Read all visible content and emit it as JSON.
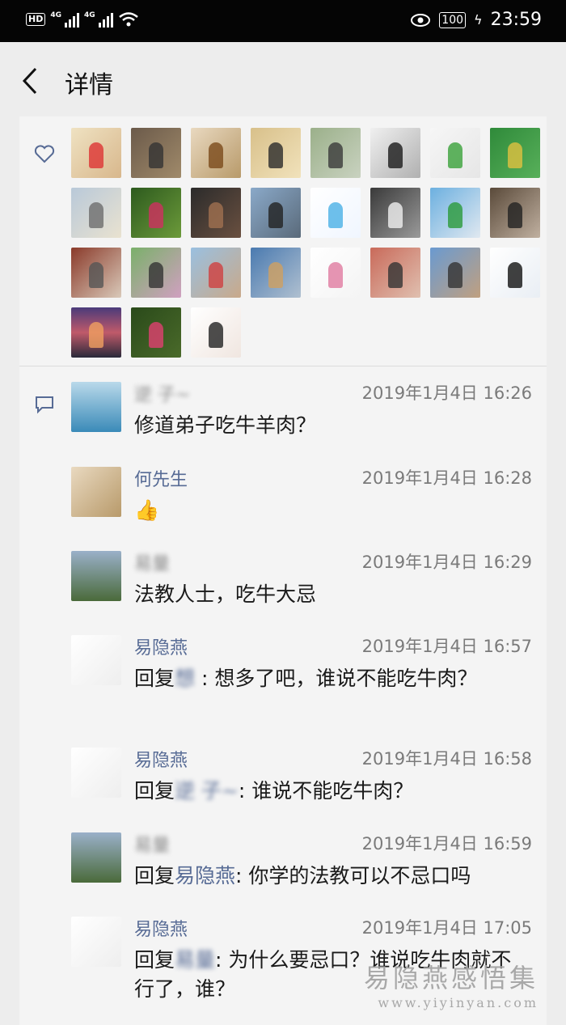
{
  "status_bar": {
    "hd": "HD",
    "network1": "4G",
    "network2": "4G",
    "battery": "100",
    "time": "23:59"
  },
  "header": {
    "title": "详情"
  },
  "likes": {
    "avatars": [
      {
        "bg": "linear-gradient(135deg,#efe2c2,#d8b78c)",
        "accent": "#d33"
      },
      {
        "bg": "linear-gradient(135deg,#6b5a4a,#a08a6a)",
        "accent": "#333"
      },
      {
        "bg": "linear-gradient(135deg,#e9d9c0,#b89a6a)",
        "accent": "#7a4a1a"
      },
      {
        "bg": "linear-gradient(135deg,#d8c08a,#f1e2bb)",
        "accent": "#2b2b2b"
      },
      {
        "bg": "linear-gradient(135deg,#9bb08a,#c9d2c0)",
        "accent": "#3a3a3a"
      },
      {
        "bg": "linear-gradient(135deg,#f0f0f0,#b0b0b0)",
        "accent": "#1a1a1a"
      },
      {
        "bg": "linear-gradient(135deg,#f6f6f6,#e6e6e6)",
        "accent": "#3aa13a"
      },
      {
        "bg": "linear-gradient(135deg,#2f8a3a,#58b05a)",
        "accent": "#e0c040"
      },
      {
        "bg": "linear-gradient(135deg,#b9c9d9,#e9e2d0)",
        "accent": "#6d6d6d"
      },
      {
        "bg": "linear-gradient(135deg,#2d5a1e,#6c9a3a)",
        "accent": "#d03060"
      },
      {
        "bg": "linear-gradient(135deg,#2b2b2b,#6a5040)",
        "accent": "#a07050"
      },
      {
        "bg": "linear-gradient(135deg,#8aa9c9,#5a6a7a)",
        "accent": "#222"
      },
      {
        "bg": "linear-gradient(135deg,#ffffff,#f0f6ff)",
        "accent": "#4ab0e6"
      },
      {
        "bg": "linear-gradient(135deg,#3a3a3a,#9a9a9a)",
        "accent": "#f0f0f0"
      },
      {
        "bg": "linear-gradient(135deg,#6cb0e0,#e0e8f0)",
        "accent": "#2a9a3a"
      },
      {
        "bg": "linear-gradient(135deg,#5a4a3a,#c0b0a0)",
        "accent": "#222"
      },
      {
        "bg": "linear-gradient(135deg,#8a3a2a,#d9c9b9)",
        "accent": "#555"
      },
      {
        "bg": "linear-gradient(135deg,#7ab06a,#d0a0c0)",
        "accent": "#333"
      },
      {
        "bg": "linear-gradient(135deg,#9ac0e0,#c9a98a)",
        "accent": "#d04040"
      },
      {
        "bg": "linear-gradient(135deg,#4a7ab0,#b0c0d0)",
        "accent": "#d0a060"
      },
      {
        "bg": "linear-gradient(135deg,#ffffff,#f4f4f4)",
        "accent": "#e07aa0"
      },
      {
        "bg": "linear-gradient(135deg,#c96a5a,#e0c0b0)",
        "accent": "#333"
      },
      {
        "bg": "linear-gradient(135deg,#6a9ad0,#c0a080)",
        "accent": "#333"
      },
      {
        "bg": "linear-gradient(135deg,#ffffff,#e9eef4)",
        "accent": "#111"
      },
      {
        "bg": "linear-gradient(180deg,#4a3a7a,#c05a6a,#2a2a3a)",
        "accent": "#f0a060"
      },
      {
        "bg": "linear-gradient(135deg,#2a4a1a,#4a6a2a)",
        "accent": "#e04070"
      },
      {
        "bg": "linear-gradient(135deg,#ffffff,#f0e6e0)",
        "accent": "#222"
      }
    ]
  },
  "comments": [
    {
      "name": "逆 子~",
      "time": "2019年1月4日 16:26",
      "text": "修道弟子吃牛羊肉？",
      "avatar": "linear-gradient(180deg,#b9d9ea,#3a8ab8)"
    },
    {
      "name": "何先生",
      "time": "2019年1月4日 16:28",
      "text": "👍",
      "avatar": "linear-gradient(135deg,#e9d9c0,#b89a6a)"
    },
    {
      "name": "易量",
      "time": "2019年1月4日 16:29",
      "text": "法教人士，吃牛大忌",
      "avatar": "linear-gradient(180deg,#9ab0c9,#4a6a3a)"
    },
    {
      "name": "易隐燕",
      "time": "2019年1月4日 16:57",
      "reply_prefix": "回复",
      "reply_to": "想 ",
      "text": ": 想多了吧，谁说不能吃牛肉？",
      "avatar": "linear-gradient(135deg,#ffffff,#eeeeee)"
    },
    {
      "name": "易隐燕",
      "time": "2019年1月4日 16:58",
      "reply_prefix": "回复",
      "reply_to": "逆 子~",
      "text": ": 谁说不能吃牛肉？",
      "avatar": "linear-gradient(135deg,#ffffff,#eeeeee)"
    },
    {
      "name": "易量",
      "time": "2019年1月4日 16:59",
      "reply_prefix": "回复",
      "reply_to": "易隐燕",
      "text": ": 你学的法教可以不忌口吗",
      "avatar": "linear-gradient(180deg,#9ab0c9,#4a6a3a)"
    },
    {
      "name": "易隐燕",
      "time": "2019年1月4日 17:05",
      "reply_prefix": "回复",
      "reply_to": "易量",
      "text": ": 为什么要忌口？谁说吃牛肉就不行了，谁？",
      "avatar": "linear-gradient(135deg,#ffffff,#eeeeee)"
    }
  ],
  "watermark": {
    "line1": "易隐燕感悟集",
    "line2": "www.yiyinyan.com"
  }
}
